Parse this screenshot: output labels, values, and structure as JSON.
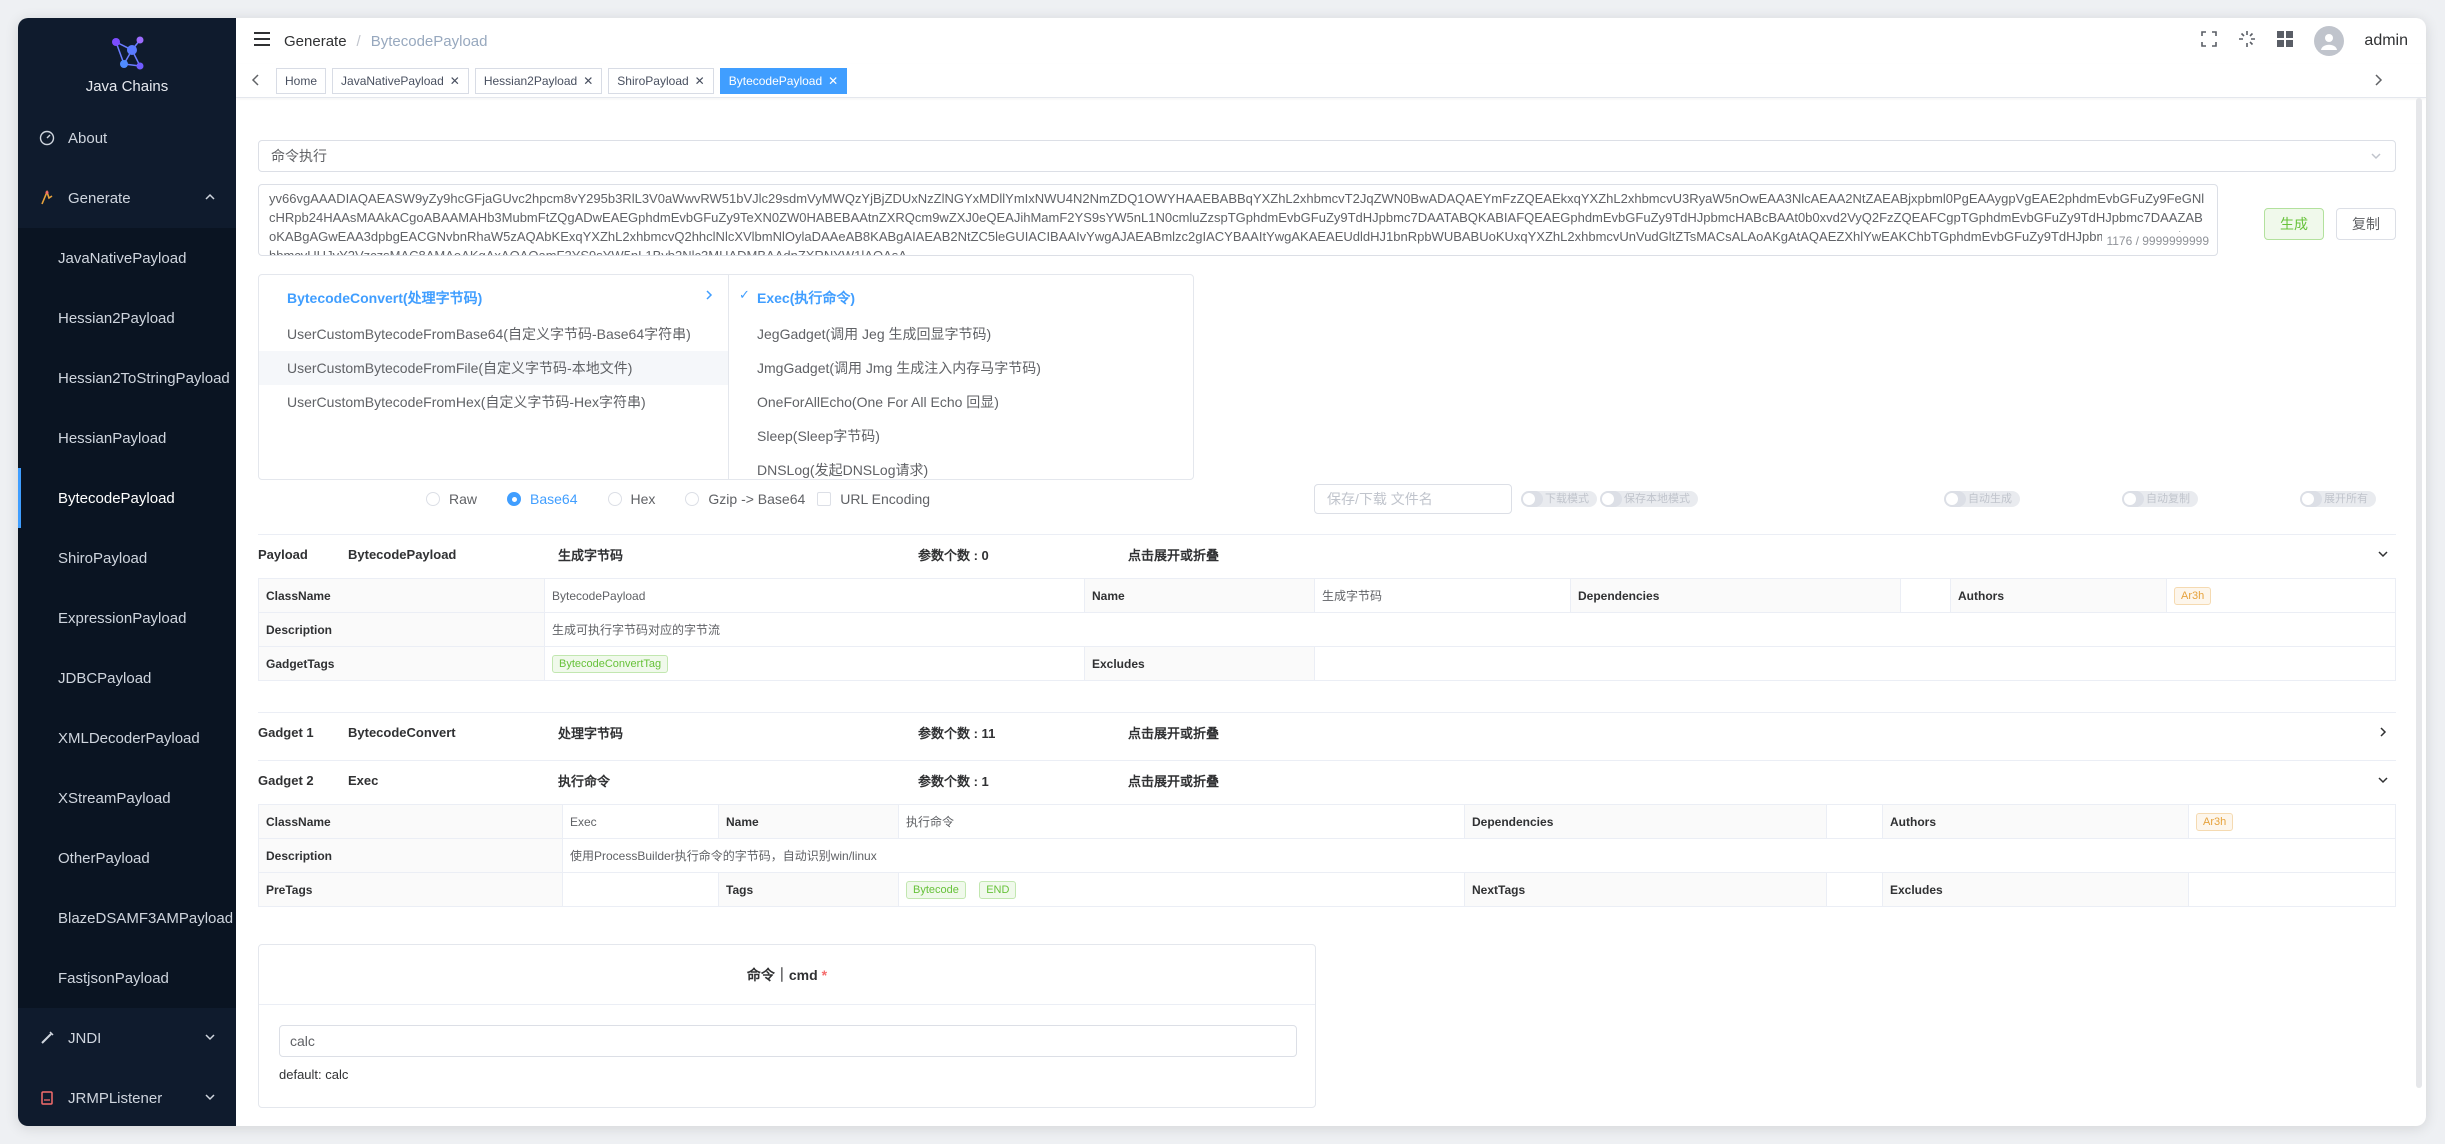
{
  "app": {
    "logo_text": "Java Chains"
  },
  "sidebar": {
    "about": "About",
    "generate": "Generate",
    "items": [
      "JavaNativePayload",
      "Hessian2Payload",
      "Hessian2ToStringPayload",
      "HessianPayload",
      "BytecodePayload",
      "ShiroPayload",
      "ExpressionPayload",
      "JDBCPayload",
      "XMLDecoderPayload",
      "XStreamPayload",
      "OtherPayload",
      "BlazeDSAMF3AMPayload",
      "FastjsonPayload"
    ],
    "jndi": "JNDI",
    "jrmp": "JRMPListener"
  },
  "header": {
    "crumb1": "Generate",
    "sep": "/",
    "crumb2": "BytecodePayload",
    "user": "admin"
  },
  "tabs": [
    "Home",
    "JavaNativePayload",
    "Hessian2Payload",
    "ShiroPayload",
    "BytecodePayload"
  ],
  "select": {
    "value": "命令执行"
  },
  "payload": {
    "text": "yv66vgAAADIAQAEASW9yZy9hcGFjaGUvc2hpcm8vY295b3RlL3V0aWwvRW51bVJlc29sdmVyMWQzYjBjZDUxNzZlNGYxMDllYmIxNWU4N2NmZDQ1OWYHAAEBABBqYXZhL2xhbmcvT2JqZWN0BwADAQAEYmFzZQEAEkxqYXZhL2xhbmcvU3RyaW5nOwEAA3NlcAEAA2NtZAEABjxpbml0PgEAAygpVgEAE2phdmEvbGFuZy9FeGNlcHRpb24HAAsMAAkACgoABAAMAHb3MubmFtZQgADwEAEGphdmEvbGFuZy9TeXN0ZW0HABEBAAtnZXRQcm9wZXJ0eQEAJihMamF2YS9sYW5nL1N0cmluZzspTGphdmEvbGFuZy9TdHJpbmc7DAATABQKABIAFQEAEGphdmEvbGFuZy9TdHJpbmcHABcBAAt0b0xvd2VyQ2FzZQEAFCgpTGphdmEvbGFuZy9TdHJpbmc7DAAZABoKABgAGwEAA3dpbgEACGNvbnRhaW5zAQAbKExqYXZhL2xhbmcvQ2hhclNlcXVlbmNlOylaDAAeAB8KABgAIAEAB2NtZC5leGUIACIBAAIvYwgAJAEABmlzc2gIACYBAAItYwgAKAEAEUdldHJ1bnRpbWUBABUoKUxqYXZhL2xhbmcvUnVudGltZTsMACsALAoAKgAtAQAEZXhlYwEAKChbTGphdmEvbGFuZy9TdHJpbmc7KUxqYXZhL2xhbmcvUHJvY2VzczsMAC8AMAoAKgAxAQAQamF2YS9sYW5nL1Byb2Nlc3MHADMBAAdnZXRNYW1lAQAsA...",
    "counter": "1176 / 9999999999"
  },
  "buttons": {
    "generate": "生成",
    "copy": "复制"
  },
  "cascader": {
    "left": [
      "BytecodeConvert(处理字节码)",
      "UserCustomBytecodeFromBase64(自定义字节码-Base64字符串)",
      "UserCustomBytecodeFromFile(自定义字节码-本地文件)",
      "UserCustomBytecodeFromHex(自定义字节码-Hex字符串)"
    ],
    "right": [
      "Exec(执行命令)",
      "JegGadget(调用 Jeg 生成回显字节码)",
      "JmgGadget(调用 Jmg 生成注入内存马字节码)",
      "OneForAllEcho(One For All Echo 回显)",
      "Sleep(Sleep字节码)",
      "DNSLog(发起DNSLog请求)"
    ]
  },
  "encoding": {
    "raw": "Raw",
    "base64": "Base64",
    "hex": "Hex",
    "gzip": "Gzip -> Base64",
    "url": "URL Encoding"
  },
  "file": {
    "placeholder": "保存/下载 文件名"
  },
  "switches": [
    "下载模式",
    "保存本地模式",
    "自动生成",
    "自动复制",
    "展开所有"
  ],
  "payload_sec": {
    "label": "Payload",
    "name": "BytecodePayload",
    "desc": "生成字节码",
    "params": "参数个数 : 0",
    "toggle": "点击展开或折叠",
    "rows": {
      "classname_lbl": "ClassName",
      "classname": "BytecodePayload",
      "name_lbl": "Name",
      "name": "生成字节码",
      "deps_lbl": "Dependencies",
      "authors_lbl": "Authors",
      "author": "Ar3h",
      "desc_lbl": "Description",
      "desc": "生成可执行字节码对应的字节流",
      "gadgettags_lbl": "GadgetTags",
      "gadgettag": "BytecodeConvertTag",
      "excludes_lbl": "Excludes"
    }
  },
  "gadget1": {
    "label": "Gadget 1",
    "name": "BytecodeConvert",
    "desc": "处理字节码",
    "params": "参数个数 : 11",
    "toggle": "点击展开或折叠"
  },
  "gadget2": {
    "label": "Gadget 2",
    "name": "Exec",
    "desc": "执行命令",
    "params": "参数个数 : 1",
    "toggle": "点击展开或折叠",
    "rows": {
      "classname_lbl": "ClassName",
      "classname": "Exec",
      "name_lbl": "Name",
      "name": "执行命令",
      "deps_lbl": "Dependencies",
      "authors_lbl": "Authors",
      "author": "Ar3h",
      "desc_lbl": "Description",
      "desc": "使用ProcessBuilder执行命令的字节码，自动识别win/linux",
      "pretags_lbl": "PreTags",
      "tags_lbl": "Tags",
      "tag1": "Bytecode",
      "tag2": "END",
      "nexttags_lbl": "NextTags",
      "excludes_lbl": "Excludes"
    }
  },
  "cmd": {
    "title": "命令｜cmd",
    "required": "*",
    "value": "calc",
    "default": "default: calc"
  }
}
